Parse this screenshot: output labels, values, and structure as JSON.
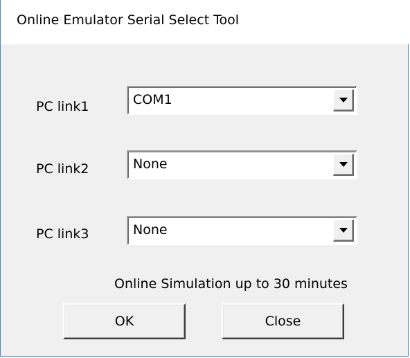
{
  "window": {
    "title": "Online Emulator Serial Select Tool"
  },
  "links": [
    {
      "label": "PC link1",
      "value": "COM1"
    },
    {
      "label": "PC link2",
      "value": "None"
    },
    {
      "label": "PC link3",
      "value": "None"
    }
  ],
  "footer": {
    "note": "Online Simulation up to 30 minutes"
  },
  "buttons": {
    "ok_label": "OK",
    "close_label": "Close"
  },
  "icons": {
    "dropdown": "chevron-down-icon"
  },
  "colors": {
    "window_border": "#4a87c7",
    "dialog_background": "#f0f0f0"
  }
}
